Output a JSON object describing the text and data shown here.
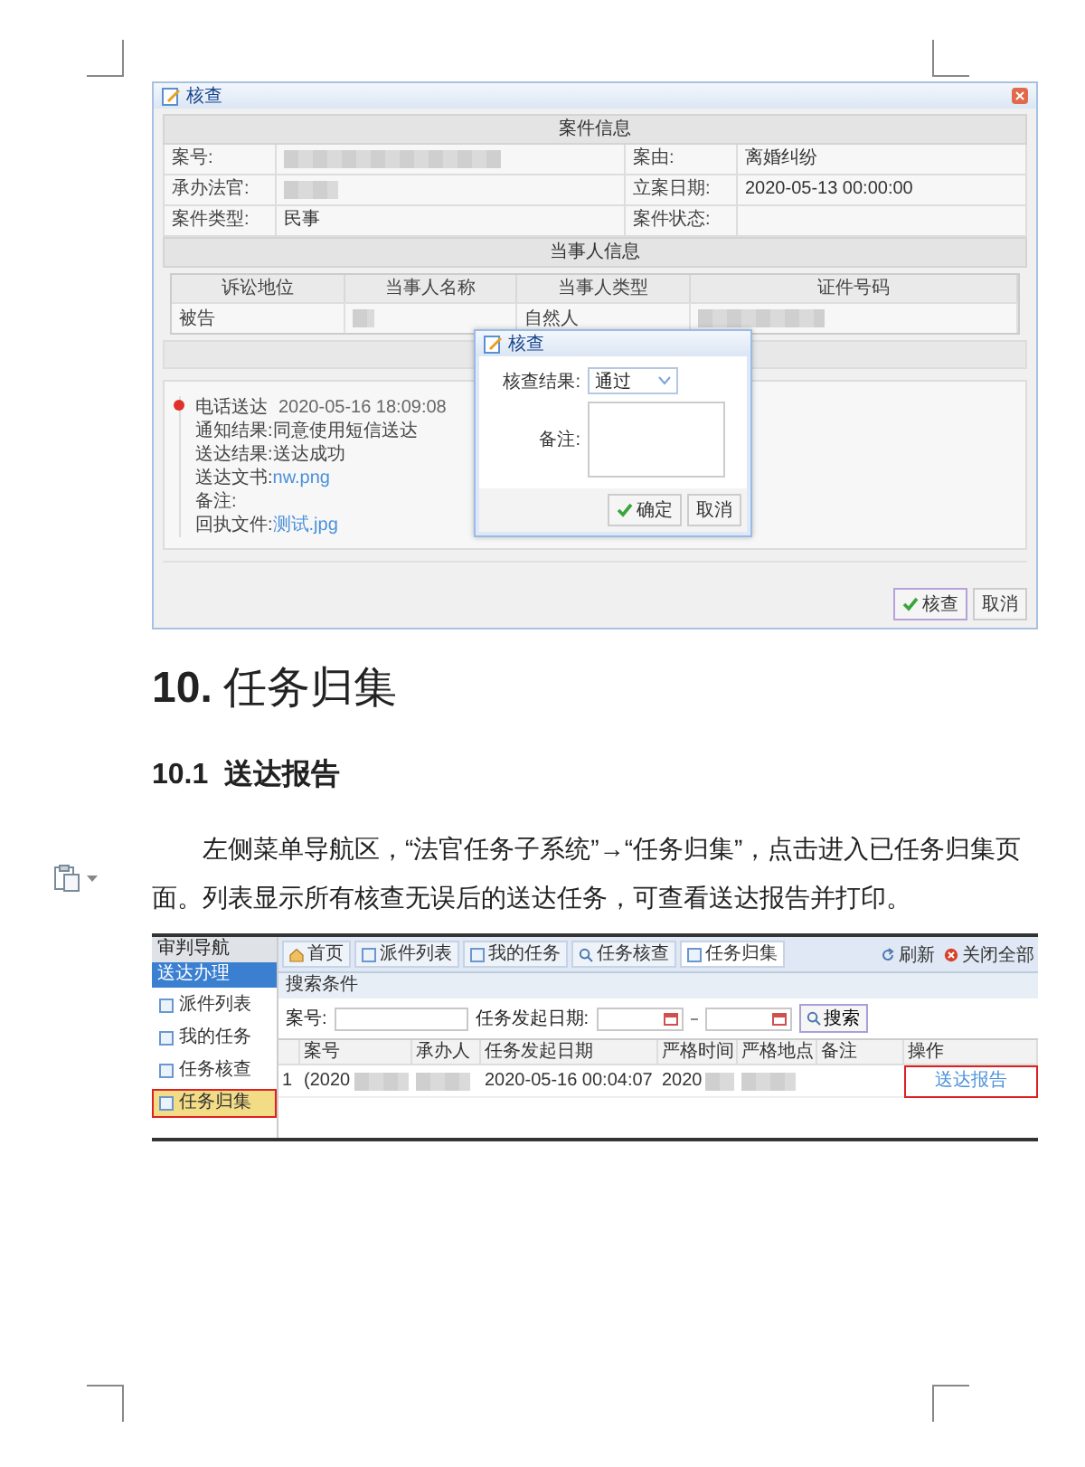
{
  "figure_1": {
    "window": {
      "title": "核查"
    },
    "case_info": {
      "heading": "案件信息",
      "fields": [
        {
          "label": "案号:",
          "redacted": true
        },
        {
          "label": "案由:",
          "value": "离婚纠纷"
        },
        {
          "label": "承办法官:",
          "redacted": true
        },
        {
          "label": "立案日期:",
          "value": "2020-05-13 00:00:00"
        },
        {
          "label": "案件类型:",
          "value": "民事"
        },
        {
          "label": "案件状态:"
        }
      ]
    },
    "parties": {
      "heading": "当事人信息",
      "columns": [
        "诉讼地位",
        "当事人名称",
        "当事人类型",
        "证件号码"
      ],
      "rows": [
        [
          {
            "text": "被告"
          },
          {
            "redacted": true
          },
          {
            "text": "自然人"
          },
          {
            "redacted": true
          }
        ]
      ]
    },
    "timeline": {
      "entries": [
        {
          "title": "电话送达",
          "time": "2020-05-16 18:09:08",
          "lines": [
            {
              "label": "通知结果:",
              "value": "同意使用短信送达"
            },
            {
              "label": "送达结果:",
              "value": "送达成功"
            },
            {
              "label": "送达文书:",
              "value": "nw.png",
              "link": true
            },
            {
              "label": "备注:"
            },
            {
              "label": "回执文件:",
              "value": "测试.jpg",
              "link": true
            }
          ]
        }
      ]
    },
    "buttons": [
      {
        "label": "核查",
        "kind": "confirm"
      },
      {
        "label": "取消",
        "kind": "cancel"
      }
    ],
    "dialog": {
      "title": "核查",
      "fields": [
        {
          "label": "核查结果:",
          "kind": "select",
          "value": "通过"
        },
        {
          "label": "备注:",
          "kind": "textarea"
        }
      ],
      "buttons": [
        {
          "label": "确定",
          "kind": "confirm"
        },
        {
          "label": "取消",
          "kind": "cancel"
        }
      ]
    }
  },
  "heading_1": {
    "number": "10.",
    "text": "任务归集"
  },
  "heading_2": {
    "number": "10.1",
    "text": "送达报告"
  },
  "paragraph": "左侧菜单导航区，“法官任务子系统”→“任务归集”，点击进入已任务归集页面。列表显示所有核查无误后的送达任务，可查看送达报告并打印。",
  "figure_2": {
    "sidebar": {
      "title": "审判导航",
      "section": "送达办理",
      "items": [
        {
          "label": "派件列表",
          "selected": false,
          "annotated": false
        },
        {
          "label": "我的任务",
          "selected": false,
          "annotated": false
        },
        {
          "label": "任务核查",
          "selected": false,
          "annotated": false
        },
        {
          "label": "任务归集",
          "selected": true,
          "annotated": true
        }
      ]
    },
    "tabs": [
      {
        "label": "首页",
        "selected": false,
        "kind": "home"
      },
      {
        "label": "派件列表",
        "selected": false,
        "kind": "page"
      },
      {
        "label": "我的任务",
        "selected": false,
        "kind": "page"
      },
      {
        "label": "任务核查",
        "selected": false,
        "kind": "search"
      },
      {
        "label": "任务归集",
        "selected": true,
        "kind": "page"
      }
    ],
    "toolbar": [
      {
        "label": "刷新",
        "kind": "refresh"
      },
      {
        "label": "关闭全部",
        "kind": "close_all"
      }
    ],
    "search": {
      "title": "搜索条件",
      "fields": [
        {
          "label": "案号:",
          "kind": "text"
        },
        {
          "label": "任务发起日期:",
          "kind": "date_range"
        }
      ],
      "button": "搜索"
    },
    "table": {
      "columns": [
        "案号",
        "承办人",
        "任务发起日期",
        "严格时间",
        "严格地点",
        "备注",
        "操作"
      ],
      "rows": [
        {
          "index": "1",
          "cells": [
            {
              "text": "(2020",
              "redacted": true
            },
            {
              "redacted": true
            },
            {
              "text": "2020-05-16 00:04:07"
            },
            {
              "text": "2020",
              "redacted": true
            },
            {
              "redacted": true
            },
            {},
            {
              "text": "送达报告",
              "link": true,
              "annotated": true
            }
          ]
        }
      ]
    }
  }
}
